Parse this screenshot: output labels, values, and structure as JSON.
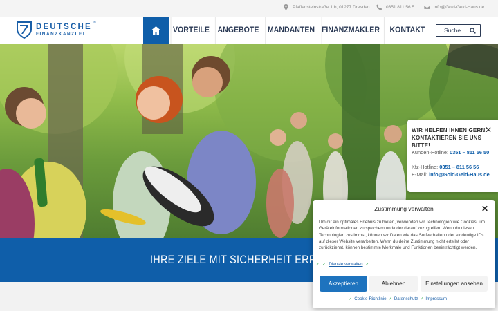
{
  "topbar": {
    "address": "Pfaffensteinstraße 1 b, 01277 Dresden",
    "phone": "0351 811 56 5",
    "email": "info@Gold-Geld-Haus.de"
  },
  "logo": {
    "line1": "DEUTSCHE",
    "registered": "®",
    "line2": "FINANZKANZLEI"
  },
  "nav": {
    "items": [
      {
        "label": "VORTEILE"
      },
      {
        "label": "ANGEBOTE"
      },
      {
        "label": "MANDANTEN"
      },
      {
        "label": "FINANZMAKLER"
      },
      {
        "label": "KONTAKT"
      }
    ],
    "search_label": "Suche"
  },
  "banner": {
    "text": "IHRE ZIELE MIT SICHERHEIT ERR"
  },
  "contact_popup": {
    "title": "WIR HELFEN IHNEN GERN. KONTAKTIEREN SIE UNS BITTE!",
    "hotline_label": "Kunden-Hotline:",
    "hotline_value": "0351 – 811 56 50",
    "kfz_label": "Kfz-Hotline:",
    "kfz_value": "0351 – 811 56 56",
    "email_label": "E-Mail:",
    "email_value": "info@Gold-Geld-Haus.de"
  },
  "consent": {
    "title": "Zustimmung verwalten",
    "body": "Um dir ein optimales Erlebnis zu bieten, verwenden wir Technologien wie Cookies, um Geräteinformationen zu speichern und/oder darauf zuzugreifen. Wenn du diesen Technologien zustimmst, können wir Daten wie das Surfverhalten oder eindeutige IDs auf dieser Website verarbeiten. Wenn du deine Zustimmung nicht erteilst oder zurückziehst, können bestimmte Merkmale und Funktionen beeinträchtigt werden.",
    "manage_link": "Dienste verwalten",
    "accept": "Akzeptieren",
    "deny": "Ablehnen",
    "settings": "Einstellungen ansehen",
    "links": [
      "Cookie-Richtlinie",
      "Datenschutz",
      "Impressum"
    ]
  },
  "colors": {
    "brand_blue": "#0f5ea9",
    "nav_text": "#2b3a55",
    "check_green": "#2aa548"
  }
}
